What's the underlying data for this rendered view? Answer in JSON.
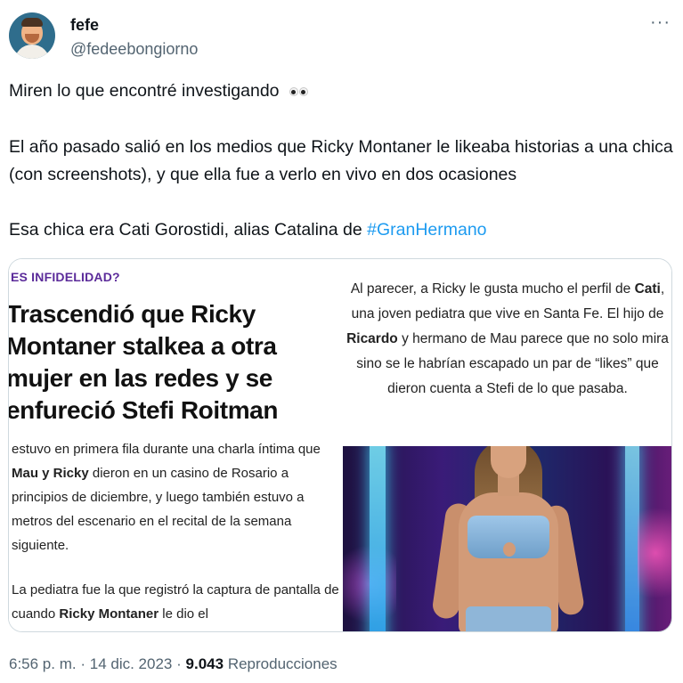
{
  "author": {
    "display_name": "fefe",
    "handle": "@fedeebongiorno"
  },
  "header": {
    "more_icon": "more-horizontal-icon",
    "more_label": "···"
  },
  "tweet": {
    "line1": "Miren lo que encontré investigando",
    "line1_emoji": "eyes-emoji",
    "paragraph2": "El año pasado salió en los medios que Ricky Montaner le likeaba historias a una chica (con screenshots), y que ella fue a verlo en vivo en dos ocasiones",
    "paragraph3_text": "Esa chica era Cati Gorostidi, alias Catalina de ",
    "hashtag": "#GranHermano"
  },
  "media": {
    "kicker": "ES INFIDELIDAD?",
    "headline_lines": [
      "Trascendió que Ricky",
      "Montaner stalkea a otra",
      "mujer en las redes y se",
      "enfureció Stefi Roitman"
    ],
    "left_paragraph1_parts": [
      "estuvo en primera fila durante una charla íntima que ",
      "Mau y Ricky",
      " dieron en un casino de Rosario a principios de diciembre, y luego también estuvo a metros del escenario en el recital de la semana siguiente."
    ],
    "left_paragraph2_parts": [
      "La pediatra fue la que registró la captura de pantalla de cuando ",
      "Ricky Montaner",
      " le dio el"
    ],
    "right_paragraph_parts": [
      "Al parecer, a Ricky le gusta mucho el perfil de ",
      "Cati",
      ", una joven pediatra que vive en Santa Fe. El hijo de ",
      "Ricardo",
      " y hermano de Mau parece que no solo mira sino se le habrían escapado un par de “likes” que dieron cuenta a Stefi de lo que pasaba."
    ],
    "colors": {
      "kicker": "#5b2b9a",
      "hashtag": "#1d9bf0"
    }
  },
  "meta": {
    "time": "6:56 p. m.",
    "sep": "·",
    "date": "14 dic. 2023",
    "views_count": "9.043",
    "views_label": "Reproducciones"
  }
}
